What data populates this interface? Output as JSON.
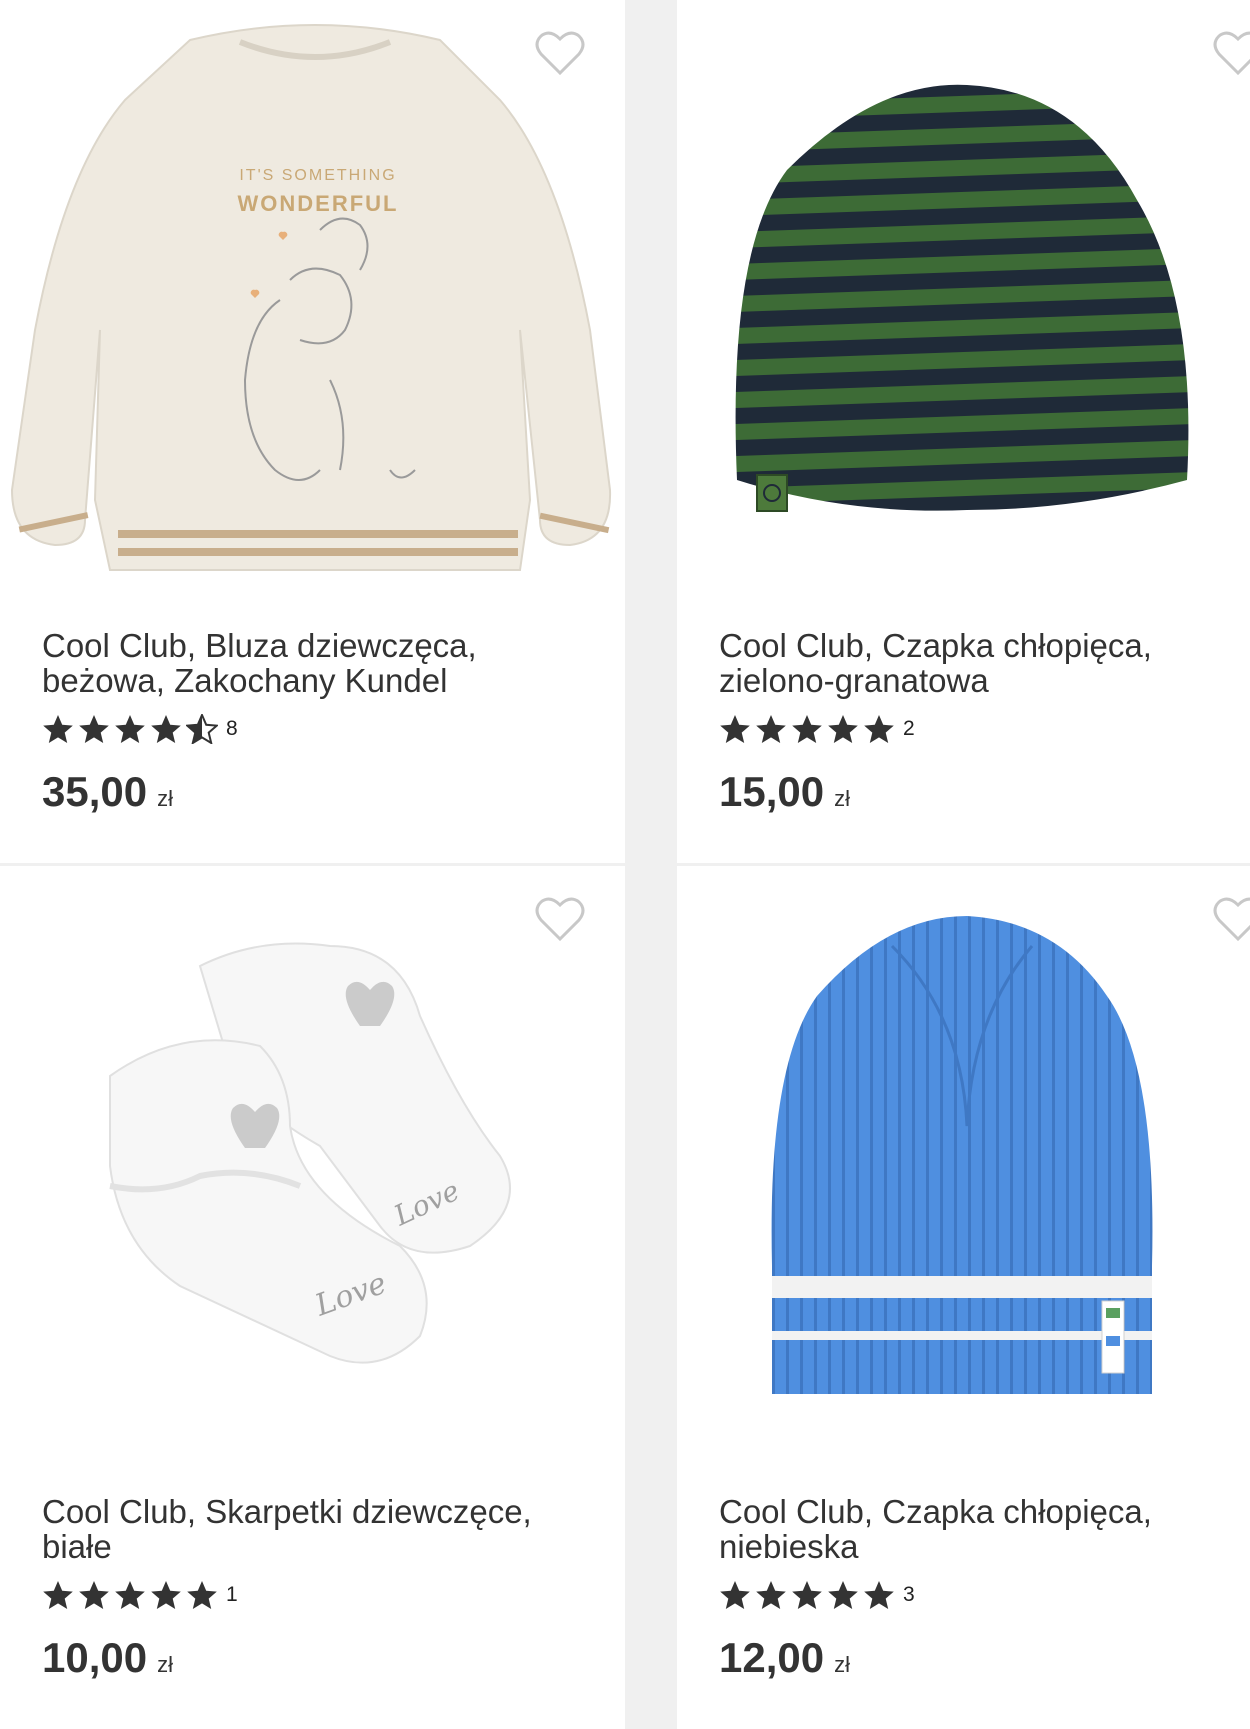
{
  "products": [
    {
      "name_line1": "Cool Club, Bluza dziewczęca,",
      "name_line2": "beżowa, Zakochany Kundel",
      "rating": 4.5,
      "review_count": "8",
      "price": "35,00",
      "currency": "zł",
      "print_line1": "IT'S SOMETHING",
      "print_line2": "WONDERFUL"
    },
    {
      "name_line1": "Cool Club, Czapka chłopięca,",
      "name_line2": "zielono-granatowa",
      "rating": 5,
      "review_count": "2",
      "price": "15,00",
      "currency": "zł"
    },
    {
      "name_line1": "Cool Club, Skarpetki dziewczęce,",
      "name_line2": "białe",
      "rating": 5,
      "review_count": "1",
      "price": "10,00",
      "currency": "zł",
      "print_text": "Love"
    },
    {
      "name_line1": "Cool Club, Czapka chłopięca,",
      "name_line2": "niebieska",
      "rating": 5,
      "review_count": "3",
      "price": "12,00",
      "currency": "zł"
    }
  ],
  "icons": {
    "favorite": "heart-outline-icon",
    "star_full": "star-filled-icon",
    "star_half": "star-half-icon"
  },
  "colors": {
    "star": "#333333",
    "heart_stroke": "#c8c8c8",
    "text": "#333333"
  }
}
